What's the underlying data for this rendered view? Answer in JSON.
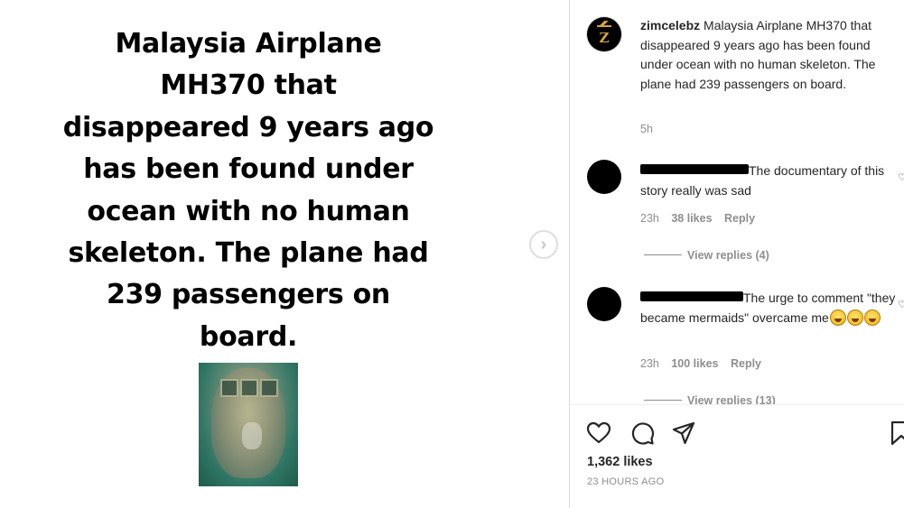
{
  "post_image": {
    "headline_lines": [
      "Malaysia Airplane",
      "MH370 that",
      "disappeared 9 years ago",
      "has been found under",
      "ocean with no human",
      "skeleton. The plane had",
      "239 passengers on",
      "board."
    ],
    "next_icon": "chevron-right-icon"
  },
  "caption": {
    "username": "zimcelebz",
    "text": "Malaysia Airplane MH370 that disappeared 9 years ago has been found under ocean with no human skeleton. The plane had 239 passengers on board.",
    "time": "5h",
    "avatar_letter": "Z"
  },
  "comments": [
    {
      "text": "The documentary of this story really was sad",
      "time": "23h",
      "likes": "38 likes",
      "reply_label": "Reply",
      "view_replies": "View replies (4)"
    },
    {
      "text": "The urge to comment \"they became mermaids\" overcame me",
      "emoji_count": 3,
      "time": "23h",
      "likes": "100 likes",
      "reply_label": "Reply",
      "view_replies": "View replies (13)"
    }
  ],
  "actions": {
    "icons": [
      "heart-icon",
      "comment-icon",
      "share-icon",
      "bookmark-icon"
    ]
  },
  "likes_count": "1,362 likes",
  "posted_ago": "23 HOURS AGO",
  "colors": {
    "text": "#262626",
    "secondary": "#8e8e8e",
    "divider": "#dbdbdb",
    "brand_gold": "#d4a437"
  }
}
